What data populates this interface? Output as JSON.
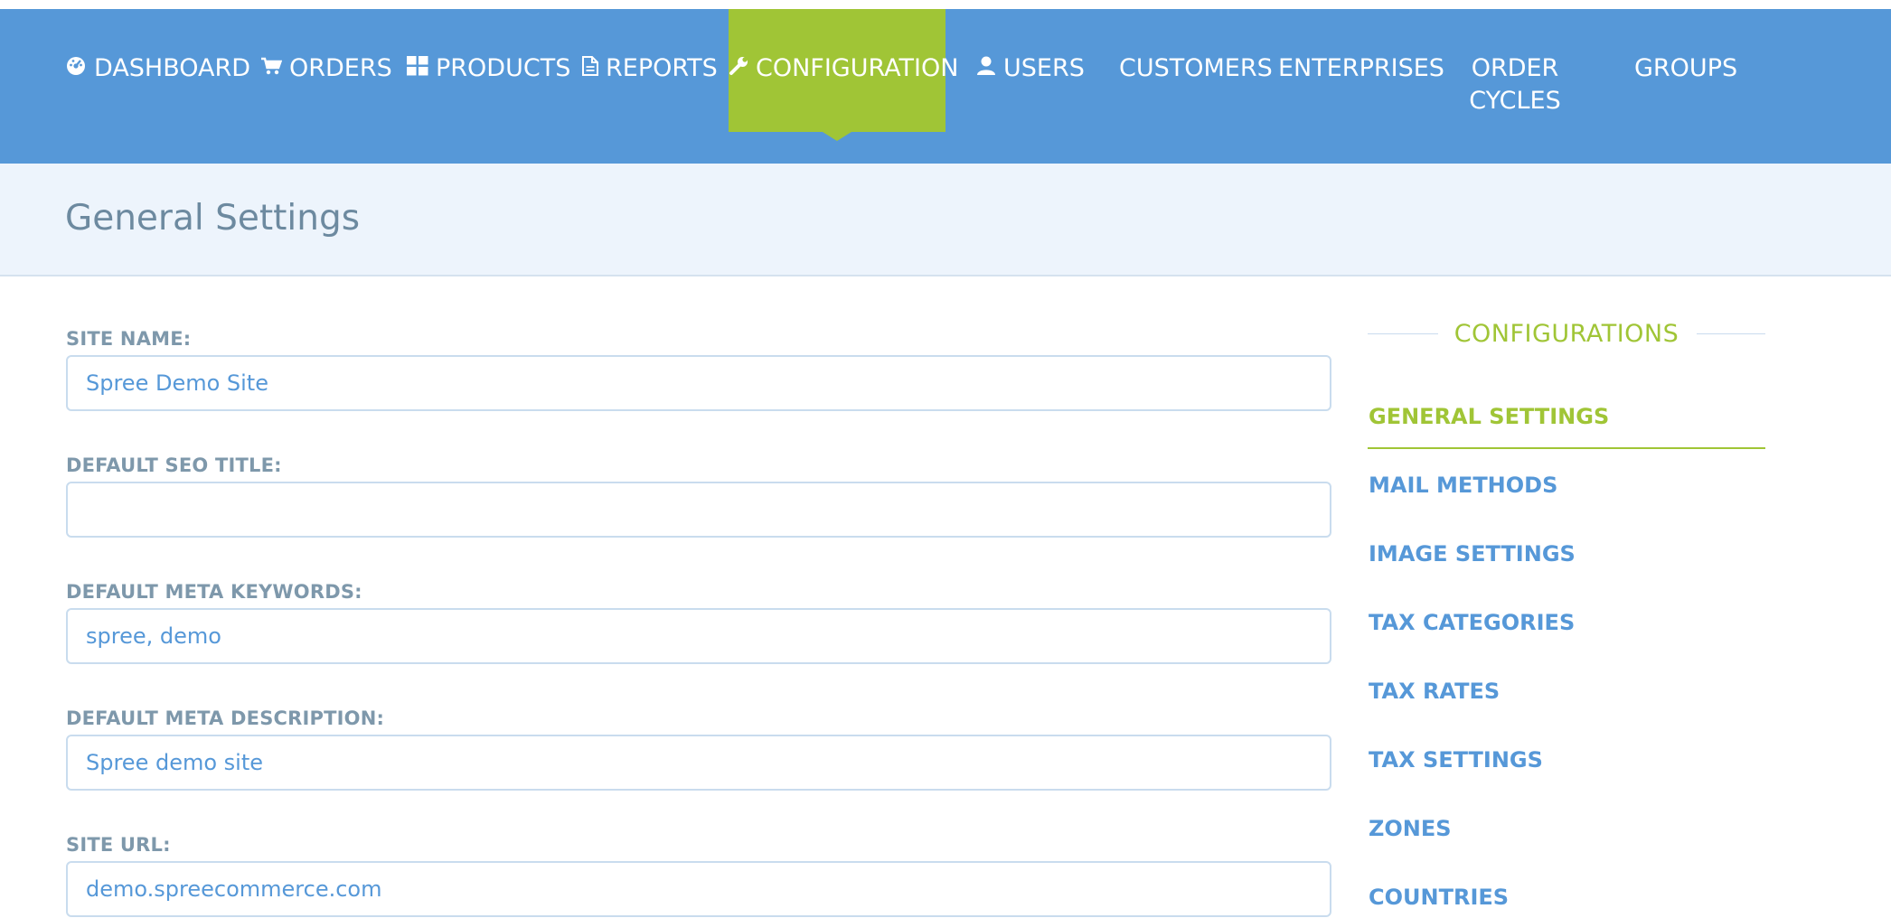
{
  "nav": {
    "items": [
      {
        "label": "DASHBOARD",
        "icon": "dashboard-icon"
      },
      {
        "label": "ORDERS",
        "icon": "cart-icon"
      },
      {
        "label": "PRODUCTS",
        "icon": "grid-icon"
      },
      {
        "label": "REPORTS",
        "icon": "file-icon"
      },
      {
        "label": "CONFIGURATION",
        "icon": "wrench-icon",
        "active": true
      },
      {
        "label": "USERS",
        "icon": "user-icon"
      },
      {
        "label": "CUSTOMERS"
      },
      {
        "label": "ENTERPRISES"
      },
      {
        "label": "ORDER CYCLES"
      },
      {
        "label": "GROUPS"
      }
    ]
  },
  "page": {
    "title": "General Settings"
  },
  "form": {
    "fields": [
      {
        "label": "SITE NAME:",
        "value": "Spree Demo Site"
      },
      {
        "label": "DEFAULT SEO TITLE:",
        "value": ""
      },
      {
        "label": "DEFAULT META KEYWORDS:",
        "value": "spree, demo"
      },
      {
        "label": "DEFAULT META DESCRIPTION:",
        "value": "Spree demo site"
      },
      {
        "label": "SITE URL:",
        "value": "demo.spreecommerce.com"
      }
    ]
  },
  "sidebar": {
    "title": "CONFIGURATIONS",
    "items": [
      {
        "label": "GENERAL SETTINGS",
        "active": true
      },
      {
        "label": "MAIL METHODS"
      },
      {
        "label": "IMAGE SETTINGS"
      },
      {
        "label": "TAX CATEGORIES"
      },
      {
        "label": "TAX RATES"
      },
      {
        "label": "TAX SETTINGS"
      },
      {
        "label": "ZONES"
      },
      {
        "label": "COUNTRIES"
      }
    ]
  },
  "colors": {
    "nav_bg": "#5698d8",
    "accent_green": "#a0c536",
    "header_bg": "#edf4fc",
    "label_gray": "#7e98ab",
    "link_blue": "#5698d8"
  }
}
